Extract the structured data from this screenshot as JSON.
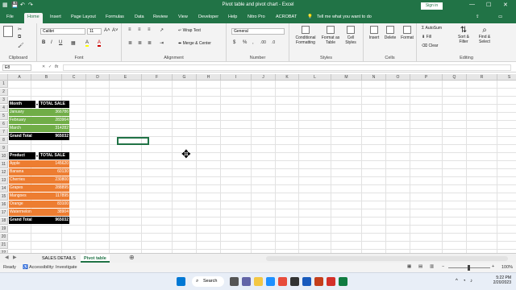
{
  "window": {
    "title": "Pivot table and pivot chart  -  Excel",
    "sign_in": "Sign in",
    "minimize": "—",
    "maximize": "☐",
    "close": "✕"
  },
  "ribbon_tabs": [
    "File",
    "Home",
    "Insert",
    "Page Layout",
    "Formulas",
    "Data",
    "Review",
    "View",
    "Developer",
    "Help",
    "Nitro Pro",
    "ACROBAT"
  ],
  "tell_me": "Tell me what you want to do",
  "ribbon": {
    "clipboard": {
      "label": "Clipboard",
      "paste": "Paste"
    },
    "font": {
      "label": "Font",
      "name": "Calibri",
      "size": "11",
      "bold": "B",
      "italic": "I",
      "underline": "U",
      "grow": "A˄",
      "shrink": "A˅",
      "fill": "A",
      "color": "A"
    },
    "alignment": {
      "label": "Alignment",
      "wrap": "Wrap Text",
      "merge": "Merge & Center"
    },
    "number": {
      "label": "Number",
      "format": "General",
      "currency": "$",
      "percent": "%",
      "comma": ",",
      "dec_inc": ".00",
      "dec_dec": ".0"
    },
    "styles": {
      "label": "Styles",
      "conditional": "Conditional Formatting",
      "format_table": "Format as Table",
      "cell_styles": "Cell Styles"
    },
    "cells": {
      "label": "Cells",
      "insert": "Insert",
      "delete": "Delete",
      "format": "Format"
    },
    "editing": {
      "label": "Editing",
      "autosum": "AutoSum",
      "fill": "Fill",
      "clear": "Clear",
      "sort": "Sort & Filter",
      "find": "Find & Select"
    }
  },
  "formula_bar": {
    "name_box": "E8",
    "fx": "fx",
    "value": ""
  },
  "columns": [
    "A",
    "B",
    "C",
    "D",
    "E",
    "F",
    "G",
    "H",
    "I",
    "J",
    "K",
    "L",
    "M",
    "N",
    "O",
    "P",
    "Q",
    "R",
    "S",
    "T"
  ],
  "rows": [
    "1",
    "2",
    "3",
    "4",
    "5",
    "6",
    "7",
    "8",
    "9",
    "10",
    "11",
    "12",
    "13",
    "14",
    "15",
    "16",
    "17",
    "18",
    "19",
    "20",
    "21",
    "22",
    "23"
  ],
  "pivot_month": {
    "headers": [
      "Month",
      "TOTAL SALE"
    ],
    "rows": [
      [
        "January",
        "366786"
      ],
      [
        "February",
        "283964"
      ],
      [
        "March",
        "314282"
      ]
    ],
    "total": [
      "Grand Total",
      "965032"
    ]
  },
  "pivot_product": {
    "headers": [
      "Product",
      "TOTAL SALE"
    ],
    "rows": [
      [
        "Apple",
        "145620"
      ],
      [
        "Banana",
        "60130"
      ],
      [
        "Cherries",
        "230800"
      ],
      [
        "Grapes",
        "288895"
      ],
      [
        "Mangoes",
        "117895"
      ],
      [
        "Orange",
        "83100"
      ],
      [
        "Watermelon",
        "38904"
      ]
    ],
    "total": [
      "Grand Total",
      "965032"
    ]
  },
  "sheets": [
    "SALES DETAILS",
    "Pivot table"
  ],
  "status": {
    "ready": "Ready",
    "accessibility": "Accessibility: Investigate",
    "zoom": "100%"
  },
  "taskbar": {
    "search": "Search",
    "time": "5:22 PM",
    "date": "2/20/2023"
  }
}
